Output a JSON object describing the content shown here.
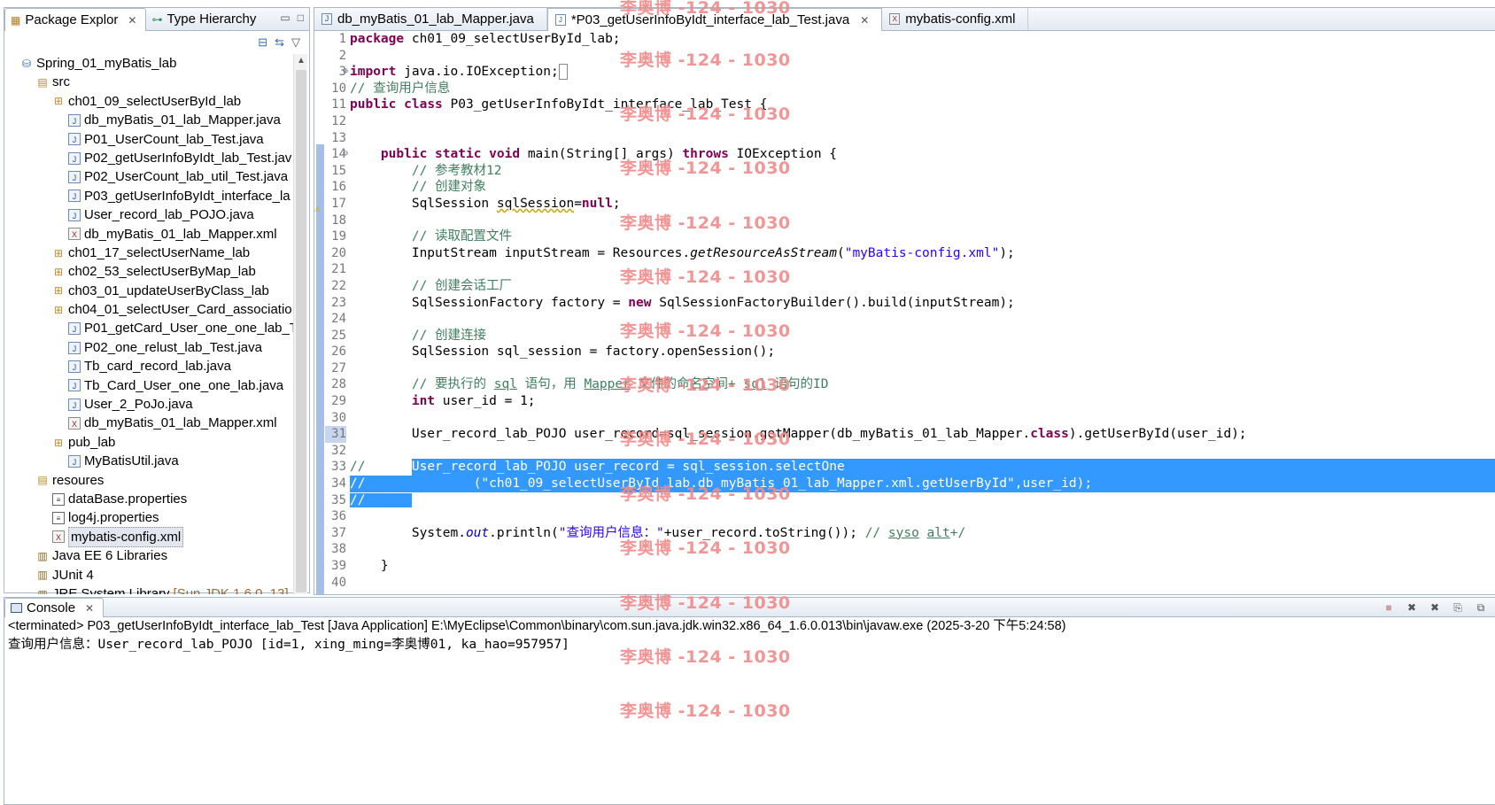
{
  "explorer": {
    "tabs": [
      {
        "label": "Package Explor",
        "active": true
      },
      {
        "label": "Type Hierarchy",
        "active": false
      }
    ],
    "tree": [
      {
        "label": "Spring_01_myBatis_lab",
        "icon": "project-icon",
        "depth": 0
      },
      {
        "label": "src",
        "icon": "source-folder-icon",
        "depth": 1
      },
      {
        "label": "ch01_09_selectUserById_lab",
        "icon": "package-icon",
        "depth": 2
      },
      {
        "label": "db_myBatis_01_lab_Mapper.java",
        "icon": "java-file-icon",
        "depth": 3
      },
      {
        "label": "P01_UserCount_lab_Test.java",
        "icon": "java-file-icon",
        "depth": 3
      },
      {
        "label": "P02_getUserInfoByIdt_lab_Test.jav",
        "icon": "java-file-icon",
        "depth": 3
      },
      {
        "label": "P02_UserCount_lab_util_Test.java",
        "icon": "java-file-icon",
        "depth": 3
      },
      {
        "label": "P03_getUserInfoByIdt_interface_la",
        "icon": "java-file-icon",
        "depth": 3
      },
      {
        "label": "User_record_lab_POJO.java",
        "icon": "java-file-icon",
        "depth": 3
      },
      {
        "label": "db_myBatis_01_lab_Mapper.xml",
        "icon": "xml-file-icon",
        "depth": 3
      },
      {
        "label": "ch01_17_selectUserName_lab",
        "icon": "package-icon",
        "depth": 2
      },
      {
        "label": "ch02_53_selectUserByMap_lab",
        "icon": "package-icon",
        "depth": 2
      },
      {
        "label": "ch03_01_updateUserByClass_lab",
        "icon": "package-icon",
        "depth": 2
      },
      {
        "label": "ch04_01_selectUser_Card_associatio",
        "icon": "package-icon",
        "depth": 2
      },
      {
        "label": "P01_getCard_User_one_one_lab_T",
        "icon": "java-file-icon",
        "depth": 3
      },
      {
        "label": "P02_one_relust_lab_Test.java",
        "icon": "java-file-icon",
        "depth": 3
      },
      {
        "label": "Tb_card_record_lab.java",
        "icon": "java-file-icon",
        "depth": 3
      },
      {
        "label": "Tb_Card_User_one_one_lab.java",
        "icon": "java-file-icon",
        "depth": 3
      },
      {
        "label": "User_2_PoJo.java",
        "icon": "java-file-icon",
        "depth": 3
      },
      {
        "label": "db_myBatis_01_lab_Mapper.xml",
        "icon": "xml-file-icon",
        "depth": 3
      },
      {
        "label": "pub_lab",
        "icon": "package-icon",
        "depth": 2
      },
      {
        "label": "MyBatisUtil.java",
        "icon": "java-file-icon",
        "depth": 3
      },
      {
        "label": "resoures",
        "icon": "source-folder-icon",
        "depth": 1
      },
      {
        "label": "dataBase.properties",
        "icon": "properties-file-icon",
        "depth": 2
      },
      {
        "label": "log4j.properties",
        "icon": "properties-file-icon",
        "depth": 2
      },
      {
        "label": "mybatis-config.xml",
        "icon": "xml-file-icon",
        "depth": 2,
        "selected": true
      },
      {
        "label": "Java EE 6 Libraries",
        "icon": "library-icon",
        "depth": 1
      },
      {
        "label": "JUnit 4",
        "icon": "library-icon",
        "depth": 1
      },
      {
        "label": "JRE System Library",
        "icon": "library-icon",
        "depth": 1,
        "suffix": "[Sun JDK 1.6.0_13]"
      }
    ]
  },
  "editor": {
    "tabs": [
      {
        "label": "db_myBatis_01_lab_Mapper.java",
        "active": false
      },
      {
        "label": "*P03_getUserInfoByIdt_interface_lab_Test.java",
        "active": true
      },
      {
        "label": "mybatis-config.xml",
        "active": false
      }
    ],
    "lines": [
      {
        "n": "1",
        "html": "<span class=\"kw\">package</span> ch01_09_selectUserById_lab;"
      },
      {
        "n": "2",
        "html": ""
      },
      {
        "n": "3",
        "fold": "⊕",
        "html": "<span class=\"kw\">import</span> java.io.IOException;<span style=\"border:1px solid #888;\">&nbsp;</span>"
      },
      {
        "n": "10",
        "html": "<span class=\"cm\">// 查询用户信息</span>"
      },
      {
        "n": "11",
        "html": "<span class=\"kw\">public</span> <span class=\"kw\">class</span> P03_getUserInfoByIdt_interface_lab_Test {"
      },
      {
        "n": "12",
        "html": ""
      },
      {
        "n": "13",
        "html": ""
      },
      {
        "n": "14",
        "fold": "⊖",
        "html": "    <span class=\"kw\">public</span> <span class=\"kw\">static</span> <span class=\"kw\">void</span> main(String[] args) <span class=\"kw\">throws</span> IOException {"
      },
      {
        "n": "15",
        "html": "        <span class=\"cm\">// 参考教材12</span>"
      },
      {
        "n": "16",
        "html": "        <span class=\"cm\">// 创建对象</span>"
      },
      {
        "n": "17",
        "html": "        SqlSession <span style=\"text-decoration:underline wavy #c9a400;\">sqlSession</span>=<span class=\"kw\">null</span>;"
      },
      {
        "n": "18",
        "html": ""
      },
      {
        "n": "19",
        "html": "        <span class=\"cm\">// 读取配置文件</span>"
      },
      {
        "n": "20",
        "html": "        InputStream inputStream = Resources.<span class=\"ital\">getResourceAsStream</span>(<span class=\"str\">\"myBatis-config.xml\"</span>);"
      },
      {
        "n": "21",
        "html": ""
      },
      {
        "n": "22",
        "html": "        <span class=\"cm\">// 创建会话工厂</span>"
      },
      {
        "n": "23",
        "html": "        SqlSessionFactory factory = <span class=\"kw\">new</span> SqlSessionFactoryBuilder().build(inputStream);"
      },
      {
        "n": "24",
        "html": ""
      },
      {
        "n": "25",
        "html": "        <span class=\"cm\">// 创建连接</span>"
      },
      {
        "n": "26",
        "html": "        SqlSession sql_session = factory.openSession();"
      },
      {
        "n": "27",
        "html": ""
      },
      {
        "n": "28",
        "html": "        <span class=\"cm\">// 要执行的 <u>sql</u> 语句，用 <u>Mapper</u> 文件的命名空间+ <u>sql</u> 语句的ID</span>"
      },
      {
        "n": "29",
        "html": "        <span class=\"kw\">int</span> user_id = 1;"
      },
      {
        "n": "30",
        "html": ""
      },
      {
        "n": "31",
        "current": true,
        "html": "        User_record_lab_POJO user_record=sql_session.getMapper(db_myBatis_01_lab_Mapper.<span class=\"kw\">class</span>).getUserById(user_id);"
      },
      {
        "n": "32",
        "html": ""
      },
      {
        "n": "33",
        "sel": "partial",
        "pre": "<span class=\"cm\">//</span>      ",
        "seltxt": "User_record_lab_POJO user_record = sql_session.selectOne"
      },
      {
        "n": "34",
        "sel": "full",
        "seltxt": "//              (\"ch01_09_selectUserById_lab.db_myBatis_01_lab_Mapper.xml.getUserById\",user_id);"
      },
      {
        "n": "35",
        "sel": "short",
        "seltxt": "//      "
      },
      {
        "n": "36",
        "html": ""
      },
      {
        "n": "37",
        "html": "        System.<span class=\"fld\">out</span>.println(<span class=\"str\">\"查询用户信息：\"</span>+user_record.toString()); <span class=\"cm\">// <u>syso</u> <u>alt</u>+/</span>"
      },
      {
        "n": "38",
        "html": ""
      },
      {
        "n": "39",
        "html": "    }"
      },
      {
        "n": "40",
        "html": ""
      }
    ]
  },
  "console": {
    "tab_label": "Console",
    "header": "<terminated> P03_getUserInfoByIdt_interface_lab_Test [Java Application] E:\\MyEclipse\\Common\\binary\\com.sun.java.jdk.win32.x86_64_1.6.0.013\\bin\\javaw.exe (2025-3-20 下午5:24:58)",
    "output": "查询用户信息：User_record_lab_POJO [id=1, xing_ming=李奥博01, ka_hao=957957]"
  },
  "watermark": "李奥博 -124 - 1030",
  "colors": {
    "keyword": "#7f0055",
    "comment": "#3f7f5f",
    "string": "#2a00ff",
    "selection": "#3399ff",
    "watermark": "#f08a8a"
  }
}
